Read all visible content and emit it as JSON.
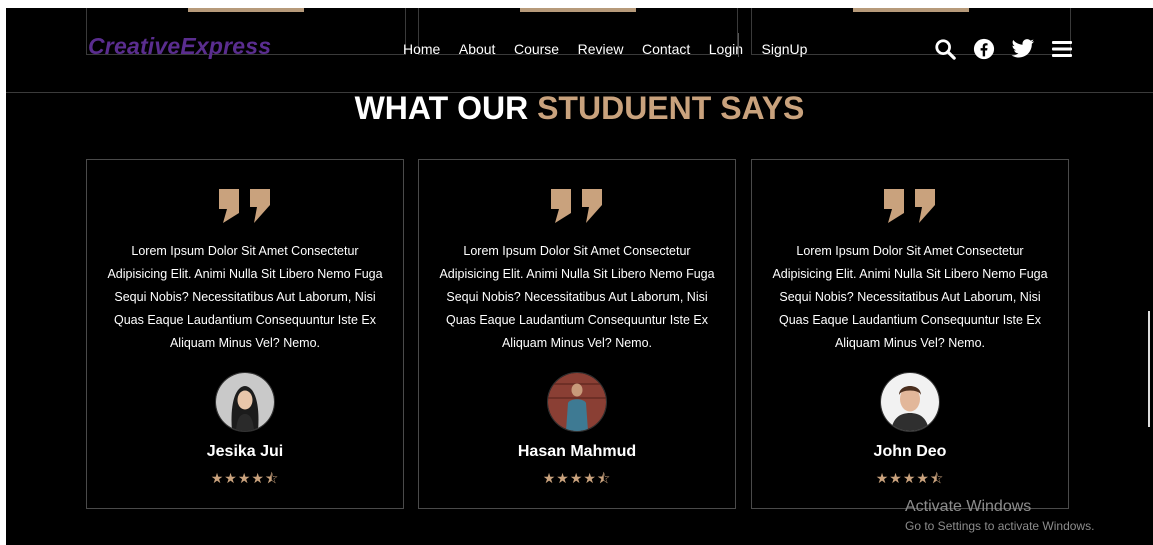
{
  "brand": {
    "name": "CreativeExpress"
  },
  "nav": {
    "items": [
      "Home",
      "About",
      "Course",
      "Review",
      "Contact",
      "Login",
      "SignUp"
    ]
  },
  "header_icons": [
    "search-icon",
    "facebook-icon",
    "twitter-icon",
    "menu-icon"
  ],
  "section": {
    "title_main": "WHAT OUR ",
    "title_accent": "STUDUENT SAYS"
  },
  "testimonials": [
    {
      "text": "Lorem Ipsum Dolor Sit Amet Consectetur Adipisicing Elit. Animi Nulla Sit Libero Nemo Fuga Sequi Nobis? Necessitatibus Aut Laborum, Nisi Quas Eaque Laudantium Consequuntur Iste Ex Aliquam Minus Vel? Nemo.",
      "name": "Jesika Jui",
      "rating": 4.5
    },
    {
      "text": "Lorem Ipsum Dolor Sit Amet Consectetur Adipisicing Elit. Animi Nulla Sit Libero Nemo Fuga Sequi Nobis? Necessitatibus Aut Laborum, Nisi Quas Eaque Laudantium Consequuntur Iste Ex Aliquam Minus Vel? Nemo.",
      "name": "Hasan Mahmud",
      "rating": 4.5
    },
    {
      "text": "Lorem Ipsum Dolor Sit Amet Consectetur Adipisicing Elit. Animi Nulla Sit Libero Nemo Fuga Sequi Nobis? Necessitatibus Aut Laborum, Nisi Quas Eaque Laudantium Consequuntur Iste Ex Aliquam Minus Vel? Nemo.",
      "name": "John Deo",
      "rating": 4.5
    }
  ],
  "colors": {
    "background": "#000000",
    "accent": "#c9a27d",
    "brand": "#5a2d8f",
    "text": "#ffffff",
    "card_border": "#4a4a4a"
  },
  "watermark": {
    "line1": "Activate Windows",
    "line2": "Go to Settings to activate Windows."
  }
}
